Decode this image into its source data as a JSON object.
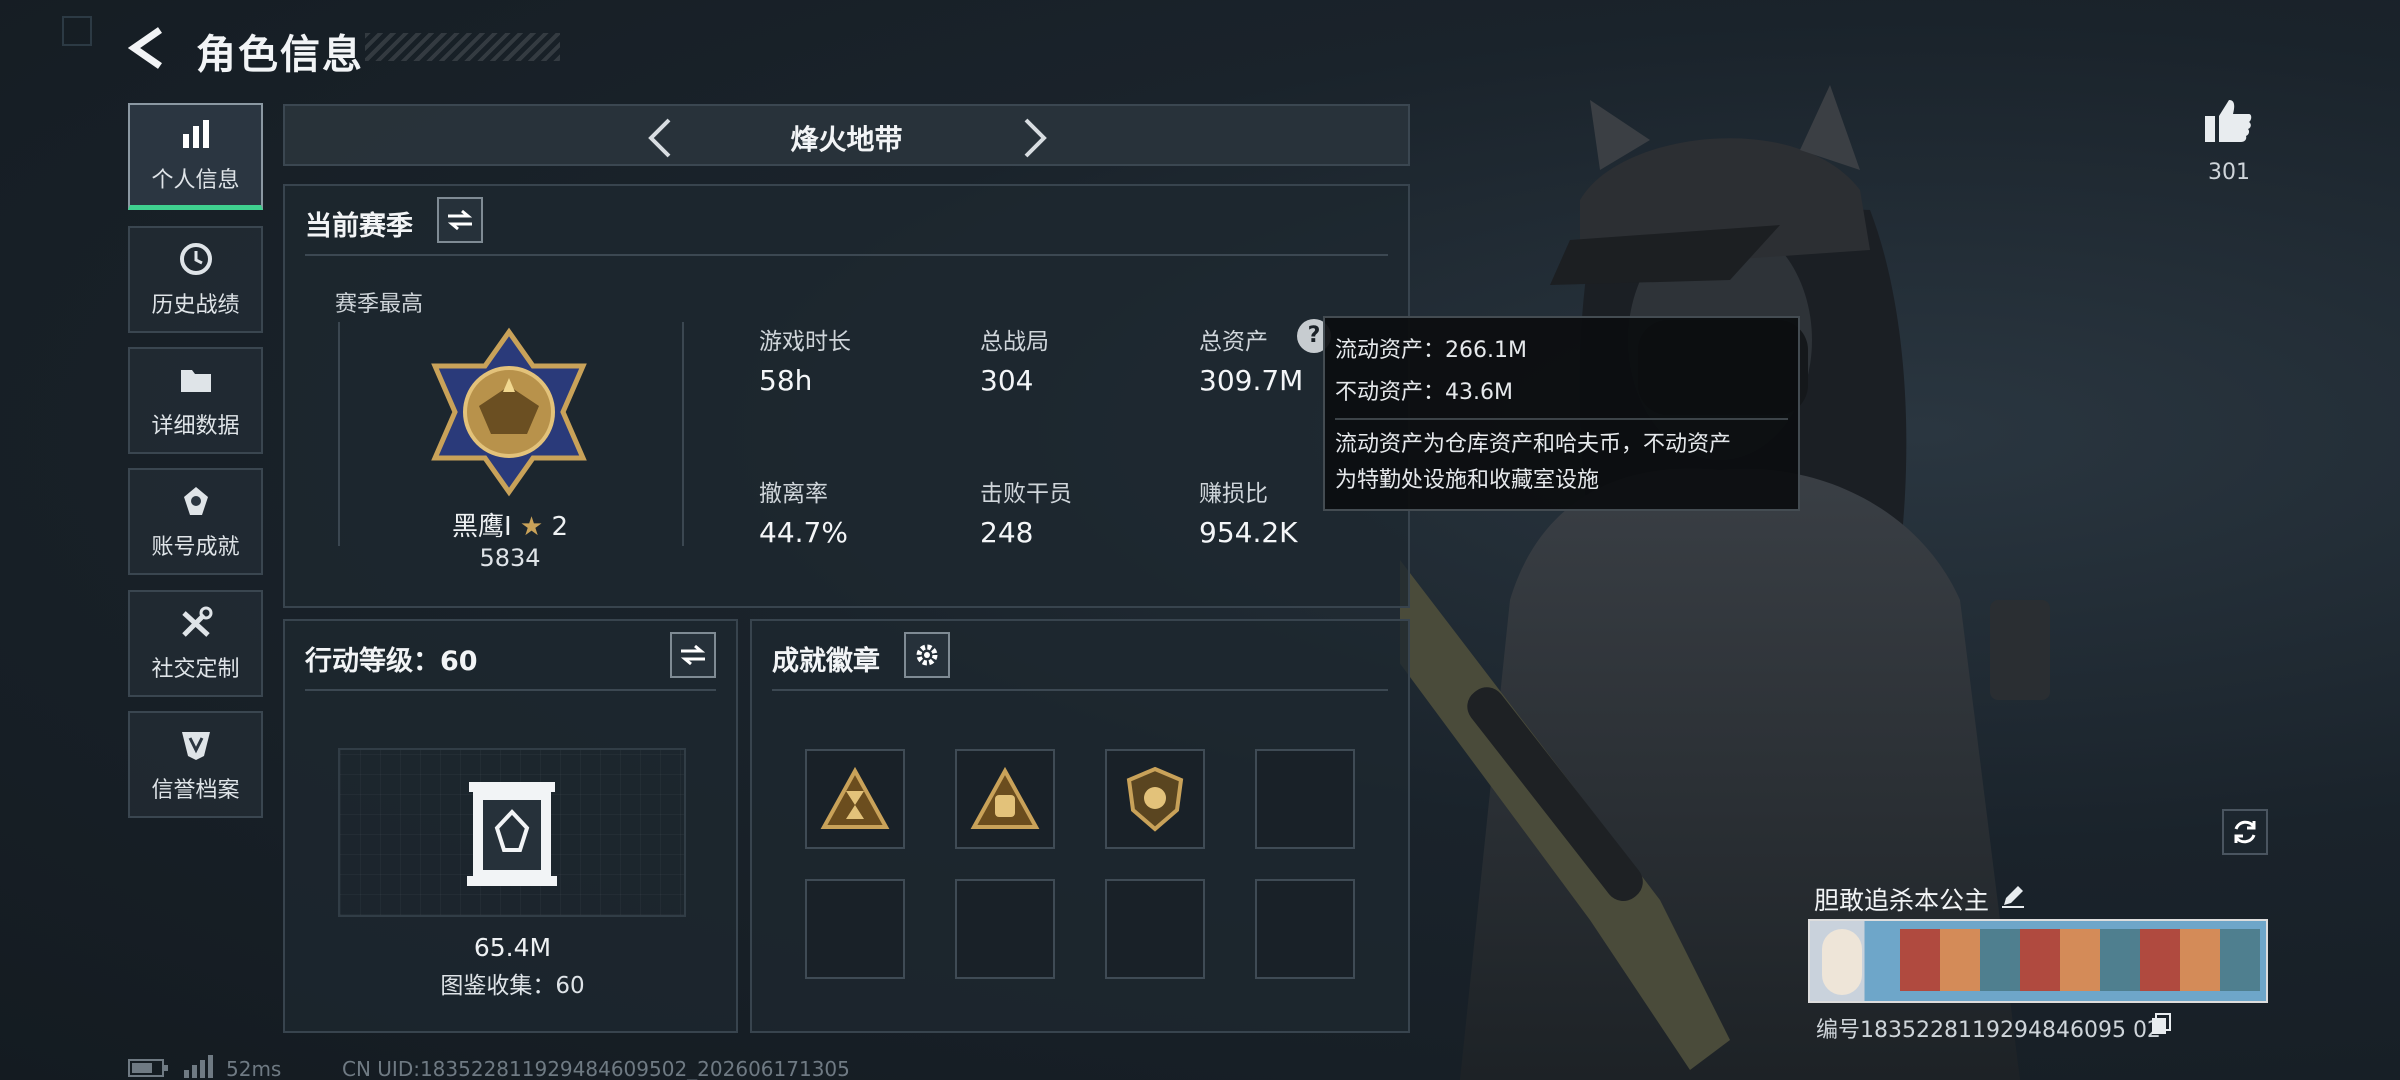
{
  "header": {
    "title": "角色信息"
  },
  "sidebar": {
    "items": [
      {
        "label": "个人信息",
        "icon": "bar-chart-icon"
      },
      {
        "label": "历史战绩",
        "icon": "history-clock-icon"
      },
      {
        "label": "详细数据",
        "icon": "folder-icon"
      },
      {
        "label": "账号成就",
        "icon": "achievement-icon"
      },
      {
        "label": "社交定制",
        "icon": "tools-icon"
      },
      {
        "label": "信誉档案",
        "icon": "credit-shield-icon"
      }
    ]
  },
  "mode": {
    "name": "烽火地带"
  },
  "season": {
    "title": "当前赛季",
    "best_label": "赛季最高",
    "rank_name": "黑鹰Ⅰ",
    "rank_stars": "2",
    "rank_points": "5834",
    "stats": [
      {
        "label": "游戏时长",
        "value": "58h"
      },
      {
        "label": "总战局",
        "value": "304"
      },
      {
        "label": "总资产",
        "value": "309.7M"
      },
      {
        "label": "撤离率",
        "value": "44.7%"
      },
      {
        "label": "击败干员",
        "value": "248"
      },
      {
        "label": "赚损比",
        "value": "954.2K"
      }
    ]
  },
  "tooltip": {
    "line1": "流动资产：266.1M",
    "line2": "不动资产：43.6M",
    "desc1": "流动资产为仓库资产和哈夫币，不动资产",
    "desc2": "为特勤处设施和收藏室设施"
  },
  "action_level": {
    "title": "行动等级：60",
    "value": "65.4M",
    "collection": "图鉴收集：60"
  },
  "achievements": {
    "title": "成就徽章",
    "badges_filled": 3,
    "slots": 8
  },
  "profile": {
    "likes": "301",
    "nickname": "胆敢追杀本公主",
    "uid_label": "编号1835228119294846095​02",
    "uid_display": "编号1835228119294846095 02"
  },
  "status_bar": {
    "ping": "52ms",
    "uid_line": "CN UID:1835228119294846095​02_202606171305"
  },
  "colors": {
    "accent_green": "#3fd18f",
    "gold": "#c9a259"
  }
}
